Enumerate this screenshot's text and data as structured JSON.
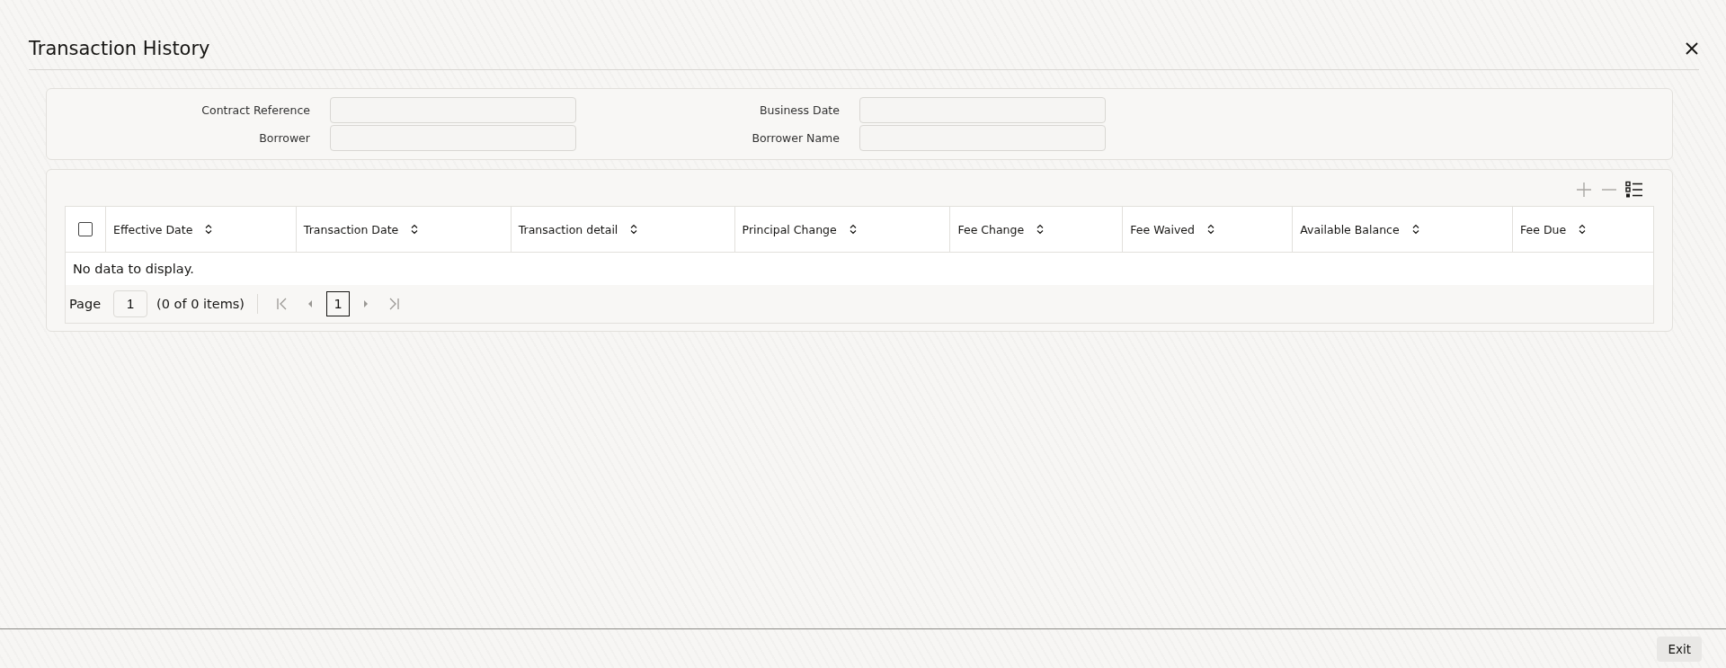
{
  "window": {
    "title": "Transaction History"
  },
  "form": {
    "fields": [
      {
        "label": "Contract Reference"
      },
      {
        "label": "Business Date"
      },
      {
        "label": "Borrower"
      },
      {
        "label": "Borrower Name"
      }
    ]
  },
  "toolbar": [
    {
      "kind": "add",
      "disabled": true
    },
    {
      "kind": "remove",
      "disabled": true
    },
    {
      "kind": "columns",
      "disabled": false
    }
  ],
  "table": {
    "select_all": {
      "checked": false
    },
    "columns": [
      {
        "label": "Effective Date"
      },
      {
        "label": "Transaction Date"
      },
      {
        "label": "Transaction detail"
      },
      {
        "label": "Principal Change"
      },
      {
        "label": "Fee Change"
      },
      {
        "label": "Fee Waived"
      },
      {
        "label": "Available Balance"
      },
      {
        "label": "Fee Due"
      }
    ],
    "empty_message": "No data to display."
  },
  "pager": {
    "label": "Page",
    "page_input": "1",
    "count": "(0 of 0 items)",
    "current_page": "1",
    "nav": [
      {
        "kind": "first",
        "disabled": true
      },
      {
        "kind": "prev",
        "disabled": true
      },
      {
        "kind": "next",
        "disabled": true
      },
      {
        "kind": "last",
        "disabled": true
      }
    ]
  },
  "footer": {
    "buttons": [
      "Exit"
    ]
  }
}
